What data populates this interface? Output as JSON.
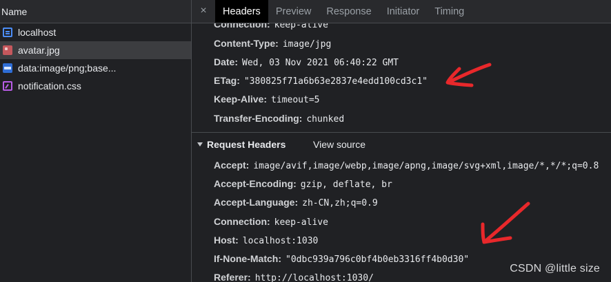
{
  "left_panel": {
    "header": "Name",
    "requests": [
      {
        "name": "localhost",
        "icon": "document-icon"
      },
      {
        "name": "avatar.jpg",
        "icon": "image-icon"
      },
      {
        "name": "data:image/png;base...",
        "icon": "png-image-icon"
      },
      {
        "name": "notification.css",
        "icon": "stylesheet-icon"
      }
    ]
  },
  "tabs": {
    "close": "×",
    "items": [
      "Headers",
      "Preview",
      "Response",
      "Initiator",
      "Timing"
    ],
    "active": "Headers"
  },
  "response_headers": [
    {
      "name": "Connection:",
      "value": "keep-alive"
    },
    {
      "name": "Content-Type:",
      "value": "image/jpg"
    },
    {
      "name": "Date:",
      "value": "Wed, 03 Nov 2021 06:40:22 GMT"
    },
    {
      "name": "ETag:",
      "value": "\"380825f71a6b63e2837e4edd100cd3c1\""
    },
    {
      "name": "Keep-Alive:",
      "value": "timeout=5"
    },
    {
      "name": "Transfer-Encoding:",
      "value": "chunked"
    }
  ],
  "request_section": {
    "title": "Request Headers",
    "view_source": "View source"
  },
  "request_headers": [
    {
      "name": "Accept:",
      "value": "image/avif,image/webp,image/apng,image/svg+xml,image/*,*/*;q=0.8"
    },
    {
      "name": "Accept-Encoding:",
      "value": "gzip, deflate, br"
    },
    {
      "name": "Accept-Language:",
      "value": "zh-CN,zh;q=0.9"
    },
    {
      "name": "Connection:",
      "value": "keep-alive"
    },
    {
      "name": "Host:",
      "value": "localhost:1030"
    },
    {
      "name": "If-None-Match:",
      "value": "\"0dbc939a796c0bf4b0eb3316ff4b0d30\""
    },
    {
      "name": "Referer:",
      "value": "http://localhost:1030/"
    }
  ],
  "annotation_color": "#e8282b",
  "watermark": "CSDN @little size"
}
